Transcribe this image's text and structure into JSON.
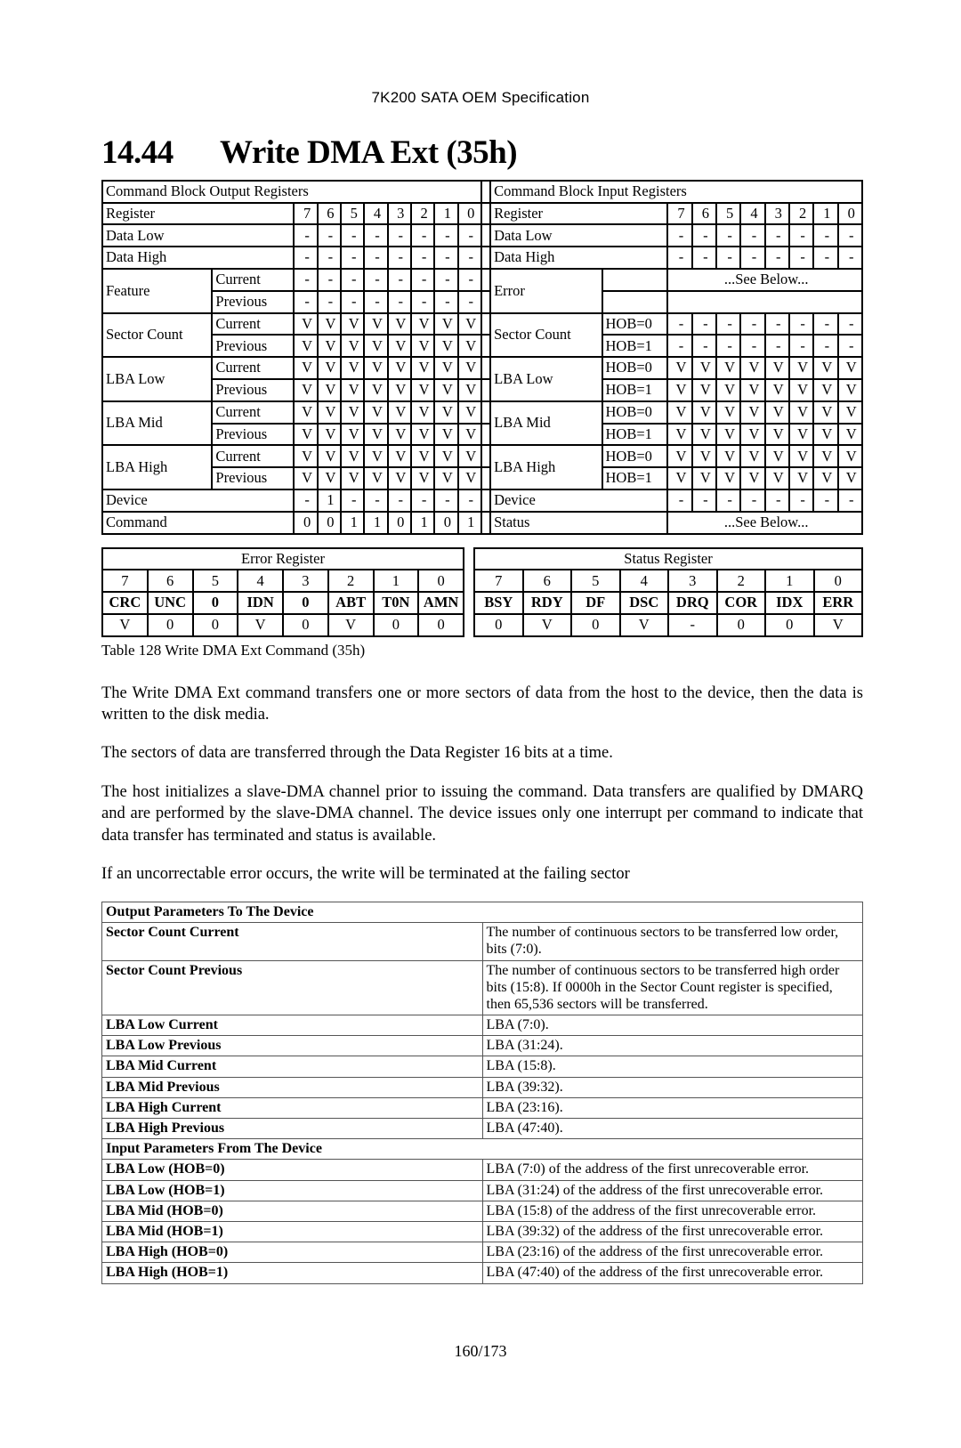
{
  "header": {
    "title": "7K200 SATA OEM Specification"
  },
  "section": {
    "number": "14.44",
    "title": "Write DMA Ext (35h)"
  },
  "output_table": {
    "title": "Command Block Output Registers",
    "bit_header_label": "Register",
    "bits": [
      "7",
      "6",
      "5",
      "4",
      "3",
      "2",
      "1",
      "0"
    ],
    "rows": [
      {
        "name": "Data Low",
        "sub": "",
        "values": [
          "-",
          "-",
          "-",
          "-",
          "-",
          "-",
          "-",
          "-"
        ]
      },
      {
        "name": "Data High",
        "sub": "",
        "values": [
          "-",
          "-",
          "-",
          "-",
          "-",
          "-",
          "-",
          "-"
        ]
      },
      {
        "name": "Feature",
        "sub": "Current",
        "values": [
          "-",
          "-",
          "-",
          "-",
          "-",
          "-",
          "-",
          "-"
        ]
      },
      {
        "name": "",
        "sub": "Previous",
        "values": [
          "-",
          "-",
          "-",
          "-",
          "-",
          "-",
          "-",
          "-"
        ]
      },
      {
        "name": "Sector Count",
        "sub": "Current",
        "values": [
          "V",
          "V",
          "V",
          "V",
          "V",
          "V",
          "V",
          "V"
        ]
      },
      {
        "name": "",
        "sub": "Previous",
        "values": [
          "V",
          "V",
          "V",
          "V",
          "V",
          "V",
          "V",
          "V"
        ]
      },
      {
        "name": "LBA Low",
        "sub": "Current",
        "values": [
          "V",
          "V",
          "V",
          "V",
          "V",
          "V",
          "V",
          "V"
        ]
      },
      {
        "name": "",
        "sub": "Previous",
        "values": [
          "V",
          "V",
          "V",
          "V",
          "V",
          "V",
          "V",
          "V"
        ]
      },
      {
        "name": "LBA Mid",
        "sub": "Current",
        "values": [
          "V",
          "V",
          "V",
          "V",
          "V",
          "V",
          "V",
          "V"
        ]
      },
      {
        "name": "",
        "sub": "Previous",
        "values": [
          "V",
          "V",
          "V",
          "V",
          "V",
          "V",
          "V",
          "V"
        ]
      },
      {
        "name": "LBA High",
        "sub": "Current",
        "values": [
          "V",
          "V",
          "V",
          "V",
          "V",
          "V",
          "V",
          "V"
        ]
      },
      {
        "name": "",
        "sub": "Previous",
        "values": [
          "V",
          "V",
          "V",
          "V",
          "V",
          "V",
          "V",
          "V"
        ]
      },
      {
        "name": "Device",
        "sub": "",
        "values": [
          "-",
          "1",
          "-",
          "-",
          "-",
          "-",
          "-",
          "-"
        ]
      },
      {
        "name": "Command",
        "sub": "",
        "values": [
          "0",
          "0",
          "1",
          "1",
          "0",
          "1",
          "0",
          "1"
        ]
      }
    ]
  },
  "input_table": {
    "title": "Command Block Input Registers",
    "bit_header_label": "Register",
    "bits": [
      "7",
      "6",
      "5",
      "4",
      "3",
      "2",
      "1",
      "0"
    ],
    "see_below": "...See Below...",
    "rows": [
      {
        "name": "Data Low",
        "sub": "",
        "values": [
          "-",
          "-",
          "-",
          "-",
          "-",
          "-",
          "-",
          "-"
        ]
      },
      {
        "name": "Data High",
        "sub": "",
        "values": [
          "-",
          "-",
          "-",
          "-",
          "-",
          "-",
          "-",
          "-"
        ]
      },
      {
        "name": "Error",
        "sub": "",
        "values": []
      },
      {
        "name": "",
        "sub": "",
        "values": []
      },
      {
        "name": "Sector Count",
        "sub": "HOB=0",
        "values": [
          "-",
          "-",
          "-",
          "-",
          "-",
          "-",
          "-",
          "-"
        ]
      },
      {
        "name": "",
        "sub": "HOB=1",
        "values": [
          "-",
          "-",
          "-",
          "-",
          "-",
          "-",
          "-",
          "-"
        ]
      },
      {
        "name": "LBA Low",
        "sub": "HOB=0",
        "values": [
          "V",
          "V",
          "V",
          "V",
          "V",
          "V",
          "V",
          "V"
        ]
      },
      {
        "name": "",
        "sub": "HOB=1",
        "values": [
          "V",
          "V",
          "V",
          "V",
          "V",
          "V",
          "V",
          "V"
        ]
      },
      {
        "name": "LBA Mid",
        "sub": "HOB=0",
        "values": [
          "V",
          "V",
          "V",
          "V",
          "V",
          "V",
          "V",
          "V"
        ]
      },
      {
        "name": "",
        "sub": "HOB=1",
        "values": [
          "V",
          "V",
          "V",
          "V",
          "V",
          "V",
          "V",
          "V"
        ]
      },
      {
        "name": "LBA High",
        "sub": "HOB=0",
        "values": [
          "V",
          "V",
          "V",
          "V",
          "V",
          "V",
          "V",
          "V"
        ]
      },
      {
        "name": "",
        "sub": "HOB=1",
        "values": [
          "V",
          "V",
          "V",
          "V",
          "V",
          "V",
          "V",
          "V"
        ]
      },
      {
        "name": "Device",
        "sub": "",
        "values": [
          "-",
          "-",
          "-",
          "-",
          "-",
          "-",
          "-",
          "-"
        ]
      },
      {
        "name": "Status",
        "sub": "",
        "values": []
      }
    ]
  },
  "error_register": {
    "title": "Error Register",
    "bits": [
      "7",
      "6",
      "5",
      "4",
      "3",
      "2",
      "1",
      "0"
    ],
    "names": [
      "CRC",
      "UNC",
      "0",
      "IDN",
      "0",
      "ABT",
      "T0N",
      "AMN"
    ],
    "values": [
      "V",
      "0",
      "0",
      "V",
      "0",
      "V",
      "0",
      "0"
    ]
  },
  "status_register": {
    "title": "Status Register",
    "bits": [
      "7",
      "6",
      "5",
      "4",
      "3",
      "2",
      "1",
      "0"
    ],
    "names": [
      "BSY",
      "RDY",
      "DF",
      "DSC",
      "DRQ",
      "COR",
      "IDX",
      "ERR"
    ],
    "values": [
      "0",
      "V",
      "0",
      "V",
      "-",
      "0",
      "0",
      "V"
    ]
  },
  "table_caption": "Table 128 Write DMA Ext Command (35h)",
  "paragraphs": [
    "The Write DMA Ext command transfers one or more sectors of data from the host to the device, then the data is written to the disk media.",
    "The sectors of data are transferred through the Data Register 16 bits at a time.",
    "The host initializes a slave-DMA channel prior to issuing the command. Data transfers are qualified by DMARQ and are performed by the slave-DMA channel. The device issues only one interrupt per command to indicate that data transfer has terminated and status is available.",
    "If an uncorrectable error occurs, the write will be terminated at the failing sector"
  ],
  "params_table": {
    "output_section": "Output Parameters To The Device",
    "output_rows": [
      {
        "name": "Sector Count Current",
        "desc": "The number of continuous sectors to be transferred low order, bits (7:0)."
      },
      {
        "name": "Sector Count Previous",
        "desc": "The number of continuous sectors to be transferred high order bits (15:8). If 0000h in the Sector Count register is specified, then 65,536 sectors will be transferred."
      },
      {
        "name": "LBA Low Current",
        "desc": "LBA (7:0)."
      },
      {
        "name": "LBA Low Previous",
        "desc": "LBA (31:24)."
      },
      {
        "name": "LBA Mid Current",
        "desc": "LBA (15:8)."
      },
      {
        "name": "LBA Mid Previous",
        "desc": "LBA (39:32)."
      },
      {
        "name": "LBA High Current",
        "desc": "LBA (23:16)."
      },
      {
        "name": "LBA High Previous",
        "desc": "LBA (47:40)."
      }
    ],
    "input_section": "Input Parameters From The Device",
    "input_rows": [
      {
        "name": "LBA Low (HOB=0)",
        "desc": "LBA (7:0) of the address of the first unrecoverable error."
      },
      {
        "name": "LBA Low (HOB=1)",
        "desc": "LBA (31:24) of the address of the first unrecoverable error."
      },
      {
        "name": "LBA Mid (HOB=0)",
        "desc": "LBA (15:8) of the address of the first unrecoverable error."
      },
      {
        "name": "LBA Mid (HOB=1)",
        "desc": "LBA (39:32) of the address of the first unrecoverable error."
      },
      {
        "name": "LBA High (HOB=0)",
        "desc": "LBA (23:16) of the address of the first unrecoverable error."
      },
      {
        "name": "LBA High (HOB=1)",
        "desc": "LBA (47:40) of the address of the first unrecoverable error."
      }
    ]
  },
  "footer": {
    "page": "160/173"
  }
}
